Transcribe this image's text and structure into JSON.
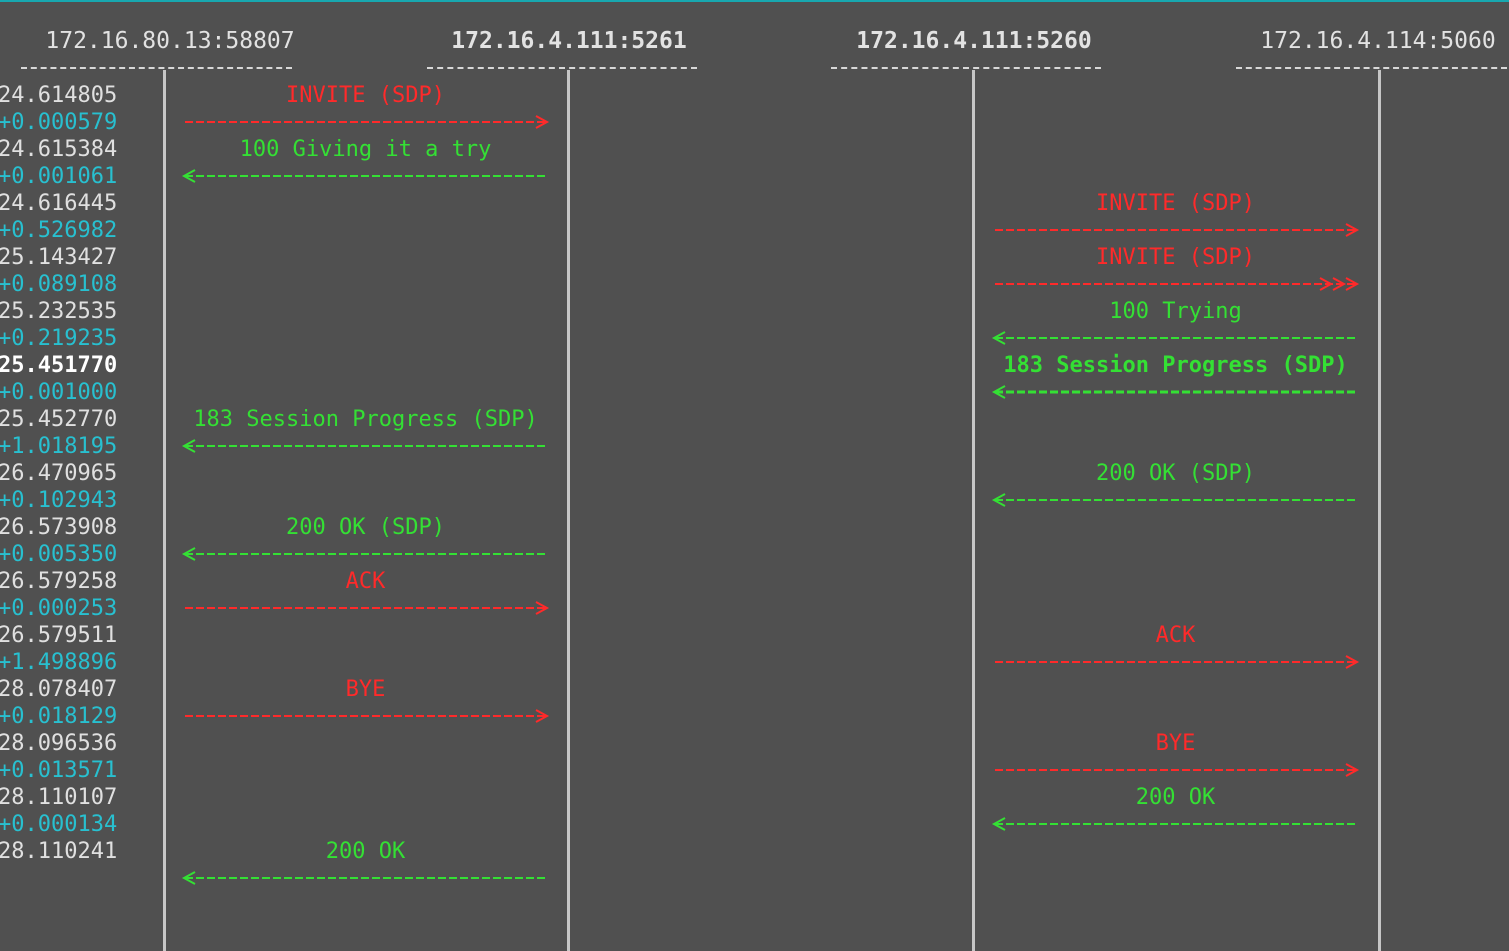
{
  "hosts": [
    "172.16.80.13:58807",
    "172.16.4.111:5261",
    "172.16.4.111:5260",
    "172.16.4.114:5060"
  ],
  "timestamps": [
    {
      "abs": "24.614805",
      "delta": "+0.000579"
    },
    {
      "abs": "24.615384",
      "delta": "+0.001061"
    },
    {
      "abs": "24.616445",
      "delta": "+0.526982"
    },
    {
      "abs": "25.143427",
      "delta": "+0.089108"
    },
    {
      "abs": "25.232535",
      "delta": "+0.219235"
    },
    {
      "abs": "25.451770",
      "delta": "+0.001000"
    },
    {
      "abs": "25.452770",
      "delta": "+1.018195"
    },
    {
      "abs": "26.470965",
      "delta": "+0.102943"
    },
    {
      "abs": "26.573908",
      "delta": "+0.005350"
    },
    {
      "abs": "26.579258",
      "delta": "+0.000253"
    },
    {
      "abs": "26.579511",
      "delta": "+1.498896"
    },
    {
      "abs": "28.078407",
      "delta": "+0.018129"
    },
    {
      "abs": "28.096536",
      "delta": "+0.013571"
    },
    {
      "abs": "28.110107",
      "delta": "+0.000134"
    },
    {
      "abs": "28.110241",
      "delta": null
    }
  ],
  "messages": [
    {
      "label": "INVITE (SDP)",
      "pair": "left",
      "dir": "right",
      "color": "red"
    },
    {
      "label": "100 Giving it a try",
      "pair": "left",
      "dir": "left",
      "color": "green"
    },
    {
      "label": "INVITE (SDP)",
      "pair": "right",
      "dir": "right",
      "color": "red"
    },
    {
      "label": "INVITE (SDP)",
      "pair": "right",
      "dir": "right",
      "color": "red",
      "retransmit": true
    },
    {
      "label": "100 Trying",
      "pair": "right",
      "dir": "left",
      "color": "green"
    },
    {
      "label": "183 Session Progress (SDP)",
      "pair": "right",
      "dir": "left",
      "color": "green",
      "highlight": true
    },
    {
      "label": "183 Session Progress (SDP)",
      "pair": "left",
      "dir": "left",
      "color": "green"
    },
    {
      "label": "200 OK (SDP)",
      "pair": "right",
      "dir": "left",
      "color": "green"
    },
    {
      "label": "200 OK (SDP)",
      "pair": "left",
      "dir": "left",
      "color": "green"
    },
    {
      "label": "ACK",
      "pair": "left",
      "dir": "right",
      "color": "red"
    },
    {
      "label": "ACK",
      "pair": "right",
      "dir": "right",
      "color": "red"
    },
    {
      "label": "BYE",
      "pair": "left",
      "dir": "right",
      "color": "red"
    },
    {
      "label": "BYE",
      "pair": "right",
      "dir": "right",
      "color": "red"
    },
    {
      "label": "200 OK",
      "pair": "right",
      "dir": "left",
      "color": "green"
    },
    {
      "label": "200 OK",
      "pair": "left",
      "dir": "left",
      "color": "green"
    }
  ],
  "colors": {
    "background": "#505050",
    "request": "#ff2a2a",
    "response": "#34e034",
    "delta": "#28c0d0",
    "timestamp": "#e0e0e0",
    "lifeline": "#c6c6c6"
  }
}
